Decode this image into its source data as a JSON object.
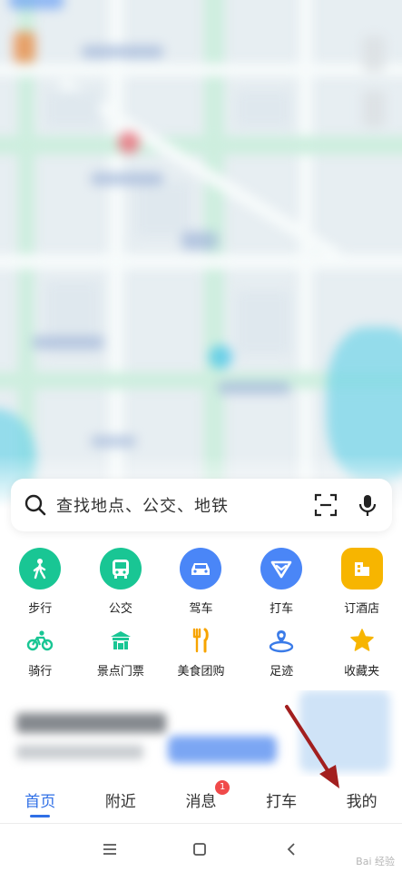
{
  "search": {
    "placeholder": "查找地点、公交、地铁",
    "search_icon": "search-icon",
    "scan_icon": "scan-icon",
    "mic_icon": "microphone-icon"
  },
  "main_actions": [
    {
      "label": "步行",
      "icon": "walk-icon",
      "color": "#19c694"
    },
    {
      "label": "公交",
      "icon": "bus-icon",
      "color": "#19c694"
    },
    {
      "label": "驾车",
      "icon": "car-icon",
      "color": "#4a86f7"
    },
    {
      "label": "打车",
      "icon": "taxi-icon",
      "color": "#4a86f7"
    },
    {
      "label": "订酒店",
      "icon": "hotel-icon",
      "color": "#f7b500"
    }
  ],
  "sub_actions": [
    {
      "label": "骑行",
      "icon": "bicycle-icon",
      "color": "#19c694"
    },
    {
      "label": "景点门票",
      "icon": "scenic-ticket-icon",
      "color": "#19c694"
    },
    {
      "label": "美食团购",
      "icon": "food-icon",
      "color": "#f7a400"
    },
    {
      "label": "足迹",
      "icon": "footprint-icon",
      "color": "#3a7be8"
    },
    {
      "label": "收藏夹",
      "icon": "star-icon",
      "color": "#f7b500"
    }
  ],
  "tabs": [
    {
      "label": "首页",
      "active": true
    },
    {
      "label": "附近",
      "active": false
    },
    {
      "label": "消息",
      "active": false,
      "badge": "1"
    },
    {
      "label": "打车",
      "active": false
    },
    {
      "label": "我的",
      "active": false
    }
  ],
  "system_nav": {
    "menu_icon": "menu-icon",
    "home_icon": "home-square-icon",
    "back_icon": "back-icon"
  },
  "watermark": "Bai 经验",
  "colors": {
    "accent": "#2f6fe6",
    "badge": "#f04a4a",
    "annotation_arrow": "#a21f1f"
  }
}
